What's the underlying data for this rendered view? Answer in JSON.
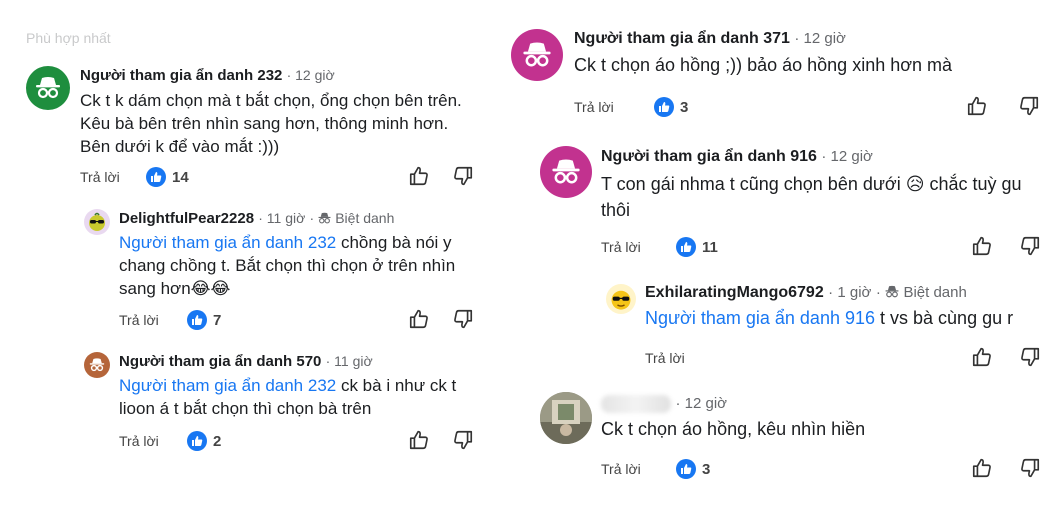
{
  "faded_top_text": "Phù hợp nhất",
  "reply_label": "Trả lời",
  "badge_label": "Biệt danh",
  "left": {
    "c1": {
      "name": "Người tham gia ẩn danh 232",
      "time": "12 giờ",
      "text": "Ck t k dám chọn mà t bắt chọn, ổng chọn bên trên. Kêu bà bên trên nhìn sang hơn, thông minh hơn. Bên dưới k để vào mắt :)))",
      "likes": "14"
    },
    "c2": {
      "name": "DelightfulPear2228",
      "time": "11 giờ",
      "mention": "Người tham gia ẩn danh 232",
      "text": " chồng bà nói y chang chồng t. Bắt chọn thì chọn ở trên nhìn sang hơn😂😂",
      "likes": "7"
    },
    "c3": {
      "name": "Người tham gia ẩn danh 570",
      "time": "11 giờ",
      "mention": "Người tham gia ẩn danh 232",
      "text": " ck bà i như ck t lioon á t bắt chọn thì chọn bà trên",
      "likes": "2"
    }
  },
  "right": {
    "c1": {
      "name": "Người tham gia ẩn danh 371",
      "time": "12 giờ",
      "text": "Ck t chọn áo hồng ;)) bảo áo hồng xinh hơn mà",
      "likes": "3"
    },
    "c2": {
      "name": "Người tham gia ẩn danh 916",
      "time": "12 giờ",
      "text": "T con gái nhma t cũng chọn bên dưới 😥 chắc tuỳ gu thôi",
      "likes": "11"
    },
    "c3": {
      "name": "ExhilaratingMango6792",
      "time": "1 giờ",
      "mention": "Người tham gia ẩn danh 916",
      "text": " t vs bà cùng gu r"
    },
    "c4": {
      "time": "12 giờ",
      "text": "Ck t chọn áo hồng, kêu nhìn hiền",
      "likes": "3"
    }
  },
  "colors": {
    "anon_green": "#1e8e3e",
    "anon_magenta": "#c2328f",
    "anon_brown": "#b5653a",
    "link_blue": "#1877f2"
  }
}
